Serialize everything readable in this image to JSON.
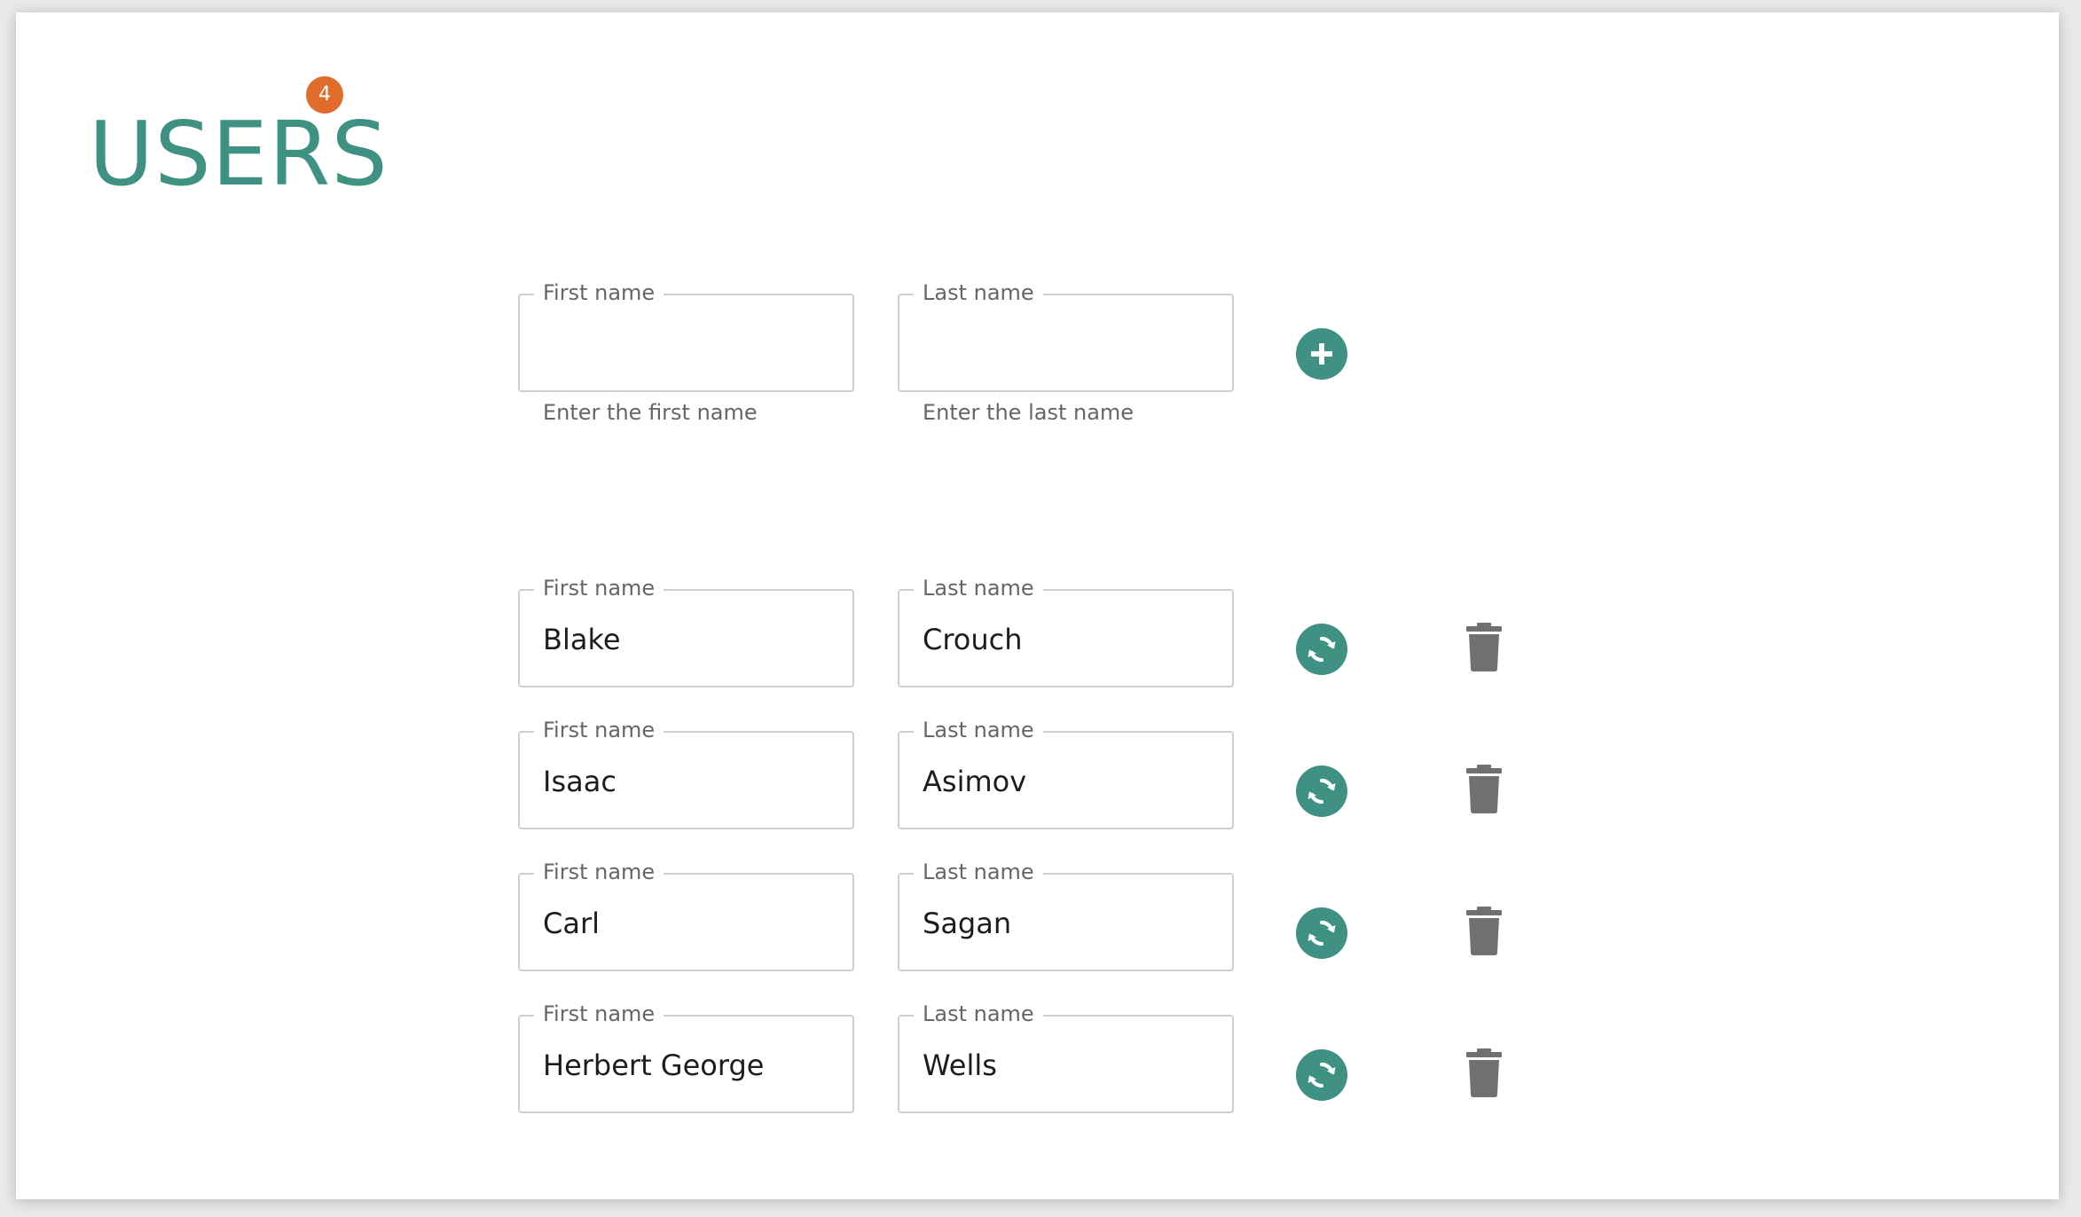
{
  "header": {
    "title": "USERS",
    "badge_count": "4"
  },
  "new_user": {
    "first_name": {
      "label": "First name",
      "value": "",
      "helper": "Enter the first name"
    },
    "last_name": {
      "label": "Last name",
      "value": "",
      "helper": "Enter the last name"
    },
    "add_icon": "plus-circle-icon"
  },
  "users": [
    {
      "first_label": "First name",
      "first": "Blake",
      "last_label": "Last name",
      "last": "Crouch"
    },
    {
      "first_label": "First name",
      "first": "Isaac",
      "last_label": "Last name",
      "last": "Asimov"
    },
    {
      "first_label": "First name",
      "first": "Carl",
      "last_label": "Last name",
      "last": "Sagan"
    },
    {
      "first_label": "First name",
      "first": "Herbert George",
      "last_label": "Last name",
      "last": "Wells"
    }
  ],
  "icons": {
    "update": "refresh-icon",
    "delete": "trash-icon"
  },
  "colors": {
    "accent": "#3f9183",
    "badge": "#e06b2a",
    "trash": "#707070"
  }
}
